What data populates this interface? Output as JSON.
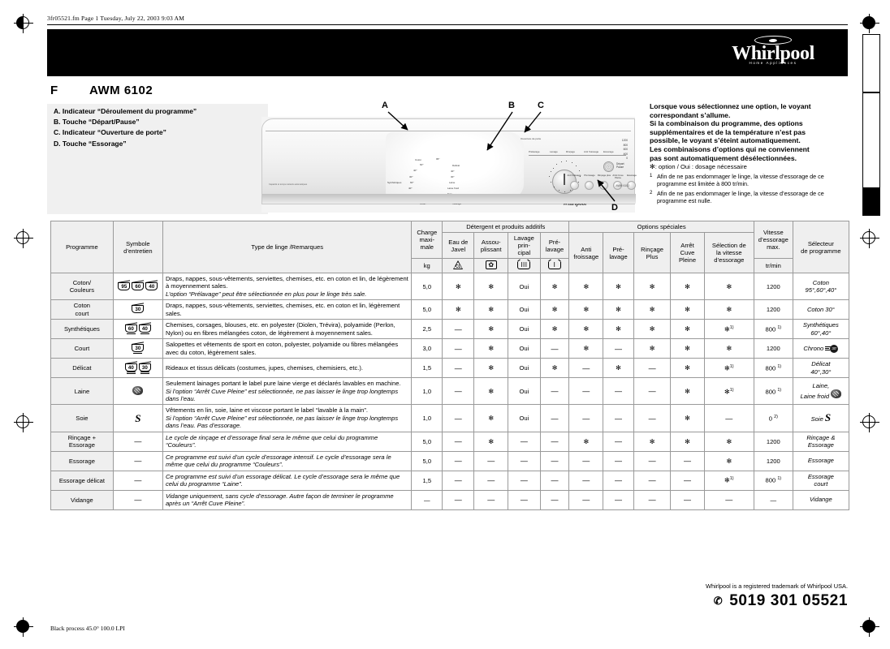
{
  "print_header": "3fr05521.fm  Page 1  Tuesday, July 22, 2003  9:03 AM",
  "print_footer": "Black process 45.0°  100.0 LPI",
  "brand": {
    "name": "Whirlpool",
    "tagline": "Home Appliances"
  },
  "title": {
    "language": "F",
    "model": "AWM  6102"
  },
  "legend": {
    "items": [
      "A. Indicateur “Déroulement du programme”",
      "B. Touche “Départ/Pause”",
      "C. Indicateur “Ouverture de porte”",
      "D. Touche “Essorage”"
    ]
  },
  "callouts": {
    "a": "A",
    "b": "B",
    "c": "C",
    "d": "D"
  },
  "machine_panel": {
    "program_steps": [
      "Prélavage",
      "Lavage",
      "Rinçage",
      "Anti froissage",
      "Essorage"
    ],
    "door_label": "Ouverture de porte",
    "start_pause": "Départ\nPause",
    "dial_labels": [
      "Coton",
      "95°",
      "60°",
      "40°",
      "30°",
      "Synthétiques",
      "60°",
      "40°",
      "Chrono",
      "Rinçage & Essorage",
      "Court",
      "Vidange",
      "Essorage court",
      "Soie",
      "Laine froid",
      "Laine",
      "30°",
      "40°",
      "Délicat"
    ],
    "buttons": [
      "Anti froissage",
      "Pré lavage",
      "Rinçage plus",
      "Arrêt Cuve Pleine",
      "Essorage"
    ],
    "speeds": [
      "1200",
      "800",
      "600",
      "400",
      "0"
    ],
    "model_tiny": "AWM 6102",
    "fine_print": "Capacité et temps restants automatiques"
  },
  "note": {
    "lines": [
      "Lorsque vous sélectionnez une option, le voyant",
      "correspondant s’allume.",
      "Si la combinaison du programme, des options",
      "supplémentaires et de la température n’est pas",
      "possible, le voyant s’éteint automatiquement.",
      "Les combinaisons d’options qui ne conviennent",
      "pas sont automatiquement désélectionnées."
    ],
    "option_legend": ": option / Oui : dosage nécessaire",
    "footnotes": [
      {
        "ref": "1",
        "text": "Afin de ne pas endommager le linge, la vitesse d’essorage de ce programme est limitée à 800 tr/min."
      },
      {
        "ref": "2",
        "text": "Afin de ne pas endommager le linge, la vitesse d’essorage de ce programme est nulle."
      }
    ]
  },
  "table": {
    "headers": {
      "programme": "Programme",
      "symbole": "Symbole\nd’entretien",
      "type_linge": "Type de linge /Remarques",
      "charge": "Charge\nmaxi-\nmale",
      "charge_unit": "kg",
      "group_detergent": "Détergent et produits additifs",
      "eau_javel": "Eau de\nJavel",
      "assouplissant": "Assou-\nplissant",
      "lavage_principal": "Lavage\nprin-\ncipal",
      "prelavage": "Pré-\nlavage",
      "group_options": "Options spéciales",
      "anti_froissage": "Anti\nfroissage",
      "pre_lavage_opt": "Pré-\nlavage",
      "rincage_plus": "Rinçage\nPlus",
      "arret_cuve": "Arrêt\nCuve\nPleine",
      "selection_vitesse": "Sélection de\nla vitesse\nd’essorage",
      "vitesse": "Vitesse\nd’essorage\nmax.",
      "vitesse_unit": "tr/min",
      "selecteur": "Sélecteur\nde programme"
    },
    "rows": [
      {
        "programme": "Coton/\nCouleurs",
        "symbols": [
          {
            "t": "tub",
            "n": "95"
          },
          {
            "t": "tub",
            "n": "60"
          },
          {
            "t": "tub",
            "n": "40"
          }
        ],
        "desc": "Draps, nappes, sous-vêtements, serviettes, chemises, etc. en coton et lin, de légèrement à moyennement sales.",
        "desc_italic": "L’option “Prélavage” peut être sélectionnée en plus pour le linge très sale.",
        "charge": "5,0",
        "eau_javel": "opt",
        "assouplissant": "opt",
        "lavage_principal": "Oui",
        "prelavage": "opt",
        "anti_froissage": "opt",
        "pre_lavage_opt": "opt",
        "rincage_plus": "opt",
        "arret_cuve": "opt",
        "selection_vitesse": "opt",
        "vitesse": "1200",
        "vitesse_fn": "",
        "selecteur": "Coton\n95°,60°,40°"
      },
      {
        "programme": "Coton\ncourt",
        "symbols": [
          {
            "t": "tub",
            "n": "30"
          }
        ],
        "desc": "Draps, nappes, sous-vêtements, serviettes, chemises, etc. en coton et lin, légèrement sales.",
        "desc_italic": "",
        "charge": "5,0",
        "eau_javel": "opt",
        "assouplissant": "opt",
        "lavage_principal": "Oui",
        "prelavage": "opt",
        "anti_froissage": "opt",
        "pre_lavage_opt": "opt",
        "rincage_plus": "opt",
        "arret_cuve": "opt",
        "selection_vitesse": "opt",
        "vitesse": "1200",
        "vitesse_fn": "",
        "selecteur": "Coton 30°"
      },
      {
        "programme": "Synthétiques",
        "symbols": [
          {
            "t": "tub",
            "n": "60",
            "bar": 1
          },
          {
            "t": "tub",
            "n": "40",
            "bar": 1
          }
        ],
        "desc": "Chemises, corsages, blouses, etc. en polyester (Diolen, Trévira), polyamide (Perlon, Nylon) ou en fibres mélangées coton, de légèrement à moyennement sales.",
        "desc_italic": "",
        "charge": "2,5",
        "eau_javel": "—",
        "assouplissant": "opt",
        "lavage_principal": "Oui",
        "prelavage": "opt",
        "anti_froissage": "opt",
        "pre_lavage_opt": "opt",
        "rincage_plus": "opt",
        "arret_cuve": "opt",
        "selection_vitesse": "opt1",
        "vitesse": "800",
        "vitesse_fn": "1)",
        "selecteur": "Synthétiques\n60°,40°"
      },
      {
        "programme": "Court",
        "symbols": [
          {
            "t": "tub",
            "n": "30",
            "bar": 1
          }
        ],
        "desc": "Salopettes et vêtements de sport en coton, polyester, polyamide ou fibres mélangées avec du coton, légèrement sales.",
        "desc_italic": "",
        "charge": "3,0",
        "eau_javel": "—",
        "assouplissant": "opt",
        "lavage_principal": "Oui",
        "prelavage": "—",
        "anti_froissage": "opt",
        "pre_lavage_opt": "—",
        "rincage_plus": "opt",
        "arret_cuve": "opt",
        "selection_vitesse": "opt",
        "vitesse": "1200",
        "vitesse_fn": "",
        "selecteur": "Chrono",
        "selecteur_icon": "chrono"
      },
      {
        "programme": "Délicat",
        "symbols": [
          {
            "t": "tub",
            "n": "40",
            "bar": 2
          },
          {
            "t": "tub",
            "n": "30",
            "bar": 2
          }
        ],
        "desc": "Rideaux et tissus délicats (costumes, jupes, chemises, chemisiers, etc.).",
        "desc_italic": "",
        "charge": "1,5",
        "eau_javel": "—",
        "assouplissant": "opt",
        "lavage_principal": "Oui",
        "prelavage": "opt",
        "anti_froissage": "—",
        "pre_lavage_opt": "opt",
        "rincage_plus": "—",
        "arret_cuve": "opt",
        "selection_vitesse": "opt1",
        "vitesse": "800",
        "vitesse_fn": "1)",
        "selecteur": "Délicat\n40°,30°"
      },
      {
        "programme": "Laine",
        "symbols": [
          {
            "t": "wool"
          }
        ],
        "desc": "Seulement lainages portant le label pure laine vierge et déclarés lavables en machine.",
        "desc_italic": "Si l’option “Arrêt Cuve Pleine” est sélectionnée, ne pas laisser le linge trop longtemps dans l’eau.",
        "charge": "1,0",
        "eau_javel": "—",
        "assouplissant": "opt",
        "lavage_principal": "Oui",
        "prelavage": "—",
        "anti_froissage": "—",
        "pre_lavage_opt": "—",
        "rincage_plus": "—",
        "arret_cuve": "opt",
        "selection_vitesse": "opt1",
        "vitesse": "800",
        "vitesse_fn": "1)",
        "selecteur": "Laine,\nLaine froid",
        "selecteur_icon": "wool"
      },
      {
        "programme": "Soie",
        "symbols": [
          {
            "t": "silk"
          }
        ],
        "desc": "Vêtements en lin, soie, laine et viscose portant le label “lavable à la main”.",
        "desc_italic": "Si l’option “Arrêt Cuve Pleine” est sélectionnée, ne pas laisser le linge trop longtemps dans l’eau. Pas d’essorage.",
        "charge": "1,0",
        "eau_javel": "—",
        "assouplissant": "opt",
        "lavage_principal": "Oui",
        "prelavage": "—",
        "anti_froissage": "—",
        "pre_lavage_opt": "—",
        "rincage_plus": "—",
        "arret_cuve": "opt",
        "selection_vitesse": "—",
        "vitesse": "0",
        "vitesse_fn": "2)",
        "selecteur": "Soie",
        "selecteur_icon": "silk"
      },
      {
        "programme": "Rinçage +\nEssorage",
        "symbols": [
          {
            "t": "dash"
          }
        ],
        "desc": "",
        "desc_italic": "Le cycle de rinçage et d’essorage final sera le même que celui du programme “Couleurs”.",
        "charge": "5,0",
        "eau_javel": "—",
        "assouplissant": "opt",
        "lavage_principal": "—",
        "prelavage": "—",
        "anti_froissage": "opt",
        "pre_lavage_opt": "—",
        "rincage_plus": "opt",
        "arret_cuve": "opt",
        "selection_vitesse": "opt",
        "vitesse": "1200",
        "vitesse_fn": "",
        "selecteur": "Rinçage &\nEssorage"
      },
      {
        "programme": "Essorage",
        "symbols": [
          {
            "t": "dash"
          }
        ],
        "desc": "",
        "desc_italic": "Ce programme est suivi d’un cycle d’essorage intensif. Le cycle d’essorage sera le même que celui du programme “Couleurs”.",
        "charge": "5,0",
        "eau_javel": "—",
        "assouplissant": "—",
        "lavage_principal": "—",
        "prelavage": "—",
        "anti_froissage": "—",
        "pre_lavage_opt": "—",
        "rincage_plus": "—",
        "arret_cuve": "—",
        "selection_vitesse": "opt",
        "vitesse": "1200",
        "vitesse_fn": "",
        "selecteur": "Essorage"
      },
      {
        "programme": "Essorage délicat",
        "symbols": [
          {
            "t": "dash"
          }
        ],
        "desc": "",
        "desc_italic": "Ce programme est suivi d’un essorage délicat. Le cycle d’essorage sera le même que celui du programme “Laine”.",
        "charge": "1,5",
        "eau_javel": "—",
        "assouplissant": "—",
        "lavage_principal": "—",
        "prelavage": "—",
        "anti_froissage": "—",
        "pre_lavage_opt": "—",
        "rincage_plus": "—",
        "arret_cuve": "—",
        "selection_vitesse": "opt1",
        "vitesse": "800",
        "vitesse_fn": "1)",
        "selecteur": "Essorage\ncourt"
      },
      {
        "programme": "Vidange",
        "symbols": [
          {
            "t": "dash"
          }
        ],
        "desc": "",
        "desc_italic": "Vidange uniquement, sans cycle d’essorage. Autre façon de terminer le programme après un “Arrêt Cuve Pleine”.",
        "charge": "—",
        "eau_javel": "—",
        "assouplissant": "—",
        "lavage_principal": "—",
        "prelavage": "—",
        "anti_froissage": "—",
        "pre_lavage_opt": "—",
        "rincage_plus": "—",
        "arret_cuve": "—",
        "selection_vitesse": "—",
        "vitesse": "—",
        "vitesse_fn": "",
        "selecteur": "Vidange"
      }
    ]
  },
  "footer": {
    "trademark": "Whirlpool is a registered trademark of Whirlpool USA.",
    "part_number": "5019 301 05521"
  }
}
